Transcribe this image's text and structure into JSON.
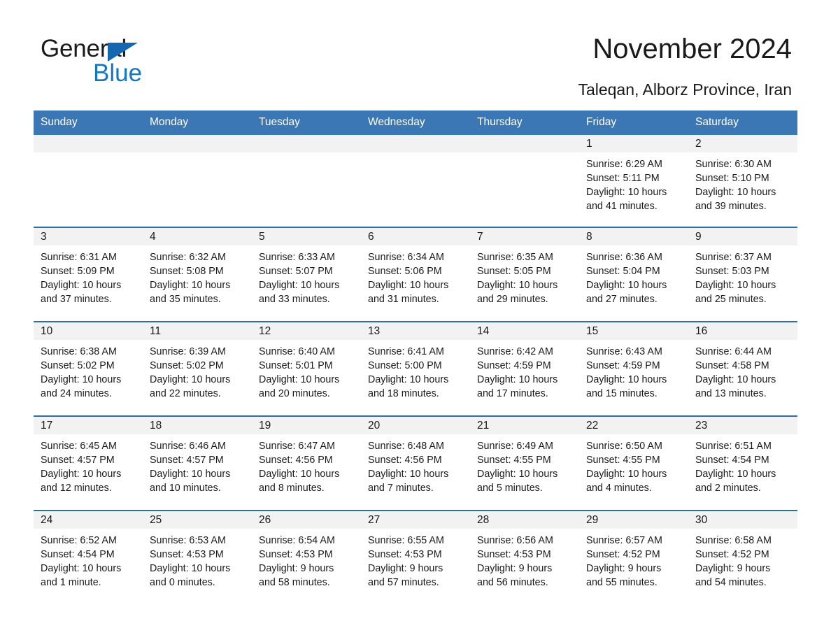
{
  "brand": {
    "name_part1": "General",
    "name_part2": "Blue",
    "triangle_color": "#1267b0",
    "blue_color": "#1276c3"
  },
  "header": {
    "title": "November 2024",
    "subtitle": "Taleqan, Alborz Province, Iran"
  },
  "theme": {
    "header_row_bg": "#3b77b5",
    "row_divider": "#2e6da4",
    "daynum_band_bg": "#f2f2f2",
    "text": "#1a1a1a"
  },
  "weekdays": [
    "Sunday",
    "Monday",
    "Tuesday",
    "Wednesday",
    "Thursday",
    "Friday",
    "Saturday"
  ],
  "weeks": [
    [
      {
        "day": "",
        "sunrise": "",
        "sunset": "",
        "daylight_line1": "",
        "daylight_line2": ""
      },
      {
        "day": "",
        "sunrise": "",
        "sunset": "",
        "daylight_line1": "",
        "daylight_line2": ""
      },
      {
        "day": "",
        "sunrise": "",
        "sunset": "",
        "daylight_line1": "",
        "daylight_line2": ""
      },
      {
        "day": "",
        "sunrise": "",
        "sunset": "",
        "daylight_line1": "",
        "daylight_line2": ""
      },
      {
        "day": "",
        "sunrise": "",
        "sunset": "",
        "daylight_line1": "",
        "daylight_line2": ""
      },
      {
        "day": "1",
        "sunrise": "Sunrise: 6:29 AM",
        "sunset": "Sunset: 5:11 PM",
        "daylight_line1": "Daylight: 10 hours",
        "daylight_line2": "and 41 minutes."
      },
      {
        "day": "2",
        "sunrise": "Sunrise: 6:30 AM",
        "sunset": "Sunset: 5:10 PM",
        "daylight_line1": "Daylight: 10 hours",
        "daylight_line2": "and 39 minutes."
      }
    ],
    [
      {
        "day": "3",
        "sunrise": "Sunrise: 6:31 AM",
        "sunset": "Sunset: 5:09 PM",
        "daylight_line1": "Daylight: 10 hours",
        "daylight_line2": "and 37 minutes."
      },
      {
        "day": "4",
        "sunrise": "Sunrise: 6:32 AM",
        "sunset": "Sunset: 5:08 PM",
        "daylight_line1": "Daylight: 10 hours",
        "daylight_line2": "and 35 minutes."
      },
      {
        "day": "5",
        "sunrise": "Sunrise: 6:33 AM",
        "sunset": "Sunset: 5:07 PM",
        "daylight_line1": "Daylight: 10 hours",
        "daylight_line2": "and 33 minutes."
      },
      {
        "day": "6",
        "sunrise": "Sunrise: 6:34 AM",
        "sunset": "Sunset: 5:06 PM",
        "daylight_line1": "Daylight: 10 hours",
        "daylight_line2": "and 31 minutes."
      },
      {
        "day": "7",
        "sunrise": "Sunrise: 6:35 AM",
        "sunset": "Sunset: 5:05 PM",
        "daylight_line1": "Daylight: 10 hours",
        "daylight_line2": "and 29 minutes."
      },
      {
        "day": "8",
        "sunrise": "Sunrise: 6:36 AM",
        "sunset": "Sunset: 5:04 PM",
        "daylight_line1": "Daylight: 10 hours",
        "daylight_line2": "and 27 minutes."
      },
      {
        "day": "9",
        "sunrise": "Sunrise: 6:37 AM",
        "sunset": "Sunset: 5:03 PM",
        "daylight_line1": "Daylight: 10 hours",
        "daylight_line2": "and 25 minutes."
      }
    ],
    [
      {
        "day": "10",
        "sunrise": "Sunrise: 6:38 AM",
        "sunset": "Sunset: 5:02 PM",
        "daylight_line1": "Daylight: 10 hours",
        "daylight_line2": "and 24 minutes."
      },
      {
        "day": "11",
        "sunrise": "Sunrise: 6:39 AM",
        "sunset": "Sunset: 5:02 PM",
        "daylight_line1": "Daylight: 10 hours",
        "daylight_line2": "and 22 minutes."
      },
      {
        "day": "12",
        "sunrise": "Sunrise: 6:40 AM",
        "sunset": "Sunset: 5:01 PM",
        "daylight_line1": "Daylight: 10 hours",
        "daylight_line2": "and 20 minutes."
      },
      {
        "day": "13",
        "sunrise": "Sunrise: 6:41 AM",
        "sunset": "Sunset: 5:00 PM",
        "daylight_line1": "Daylight: 10 hours",
        "daylight_line2": "and 18 minutes."
      },
      {
        "day": "14",
        "sunrise": "Sunrise: 6:42 AM",
        "sunset": "Sunset: 4:59 PM",
        "daylight_line1": "Daylight: 10 hours",
        "daylight_line2": "and 17 minutes."
      },
      {
        "day": "15",
        "sunrise": "Sunrise: 6:43 AM",
        "sunset": "Sunset: 4:59 PM",
        "daylight_line1": "Daylight: 10 hours",
        "daylight_line2": "and 15 minutes."
      },
      {
        "day": "16",
        "sunrise": "Sunrise: 6:44 AM",
        "sunset": "Sunset: 4:58 PM",
        "daylight_line1": "Daylight: 10 hours",
        "daylight_line2": "and 13 minutes."
      }
    ],
    [
      {
        "day": "17",
        "sunrise": "Sunrise: 6:45 AM",
        "sunset": "Sunset: 4:57 PM",
        "daylight_line1": "Daylight: 10 hours",
        "daylight_line2": "and 12 minutes."
      },
      {
        "day": "18",
        "sunrise": "Sunrise: 6:46 AM",
        "sunset": "Sunset: 4:57 PM",
        "daylight_line1": "Daylight: 10 hours",
        "daylight_line2": "and 10 minutes."
      },
      {
        "day": "19",
        "sunrise": "Sunrise: 6:47 AM",
        "sunset": "Sunset: 4:56 PM",
        "daylight_line1": "Daylight: 10 hours",
        "daylight_line2": "and 8 minutes."
      },
      {
        "day": "20",
        "sunrise": "Sunrise: 6:48 AM",
        "sunset": "Sunset: 4:56 PM",
        "daylight_line1": "Daylight: 10 hours",
        "daylight_line2": "and 7 minutes."
      },
      {
        "day": "21",
        "sunrise": "Sunrise: 6:49 AM",
        "sunset": "Sunset: 4:55 PM",
        "daylight_line1": "Daylight: 10 hours",
        "daylight_line2": "and 5 minutes."
      },
      {
        "day": "22",
        "sunrise": "Sunrise: 6:50 AM",
        "sunset": "Sunset: 4:55 PM",
        "daylight_line1": "Daylight: 10 hours",
        "daylight_line2": "and 4 minutes."
      },
      {
        "day": "23",
        "sunrise": "Sunrise: 6:51 AM",
        "sunset": "Sunset: 4:54 PM",
        "daylight_line1": "Daylight: 10 hours",
        "daylight_line2": "and 2 minutes."
      }
    ],
    [
      {
        "day": "24",
        "sunrise": "Sunrise: 6:52 AM",
        "sunset": "Sunset: 4:54 PM",
        "daylight_line1": "Daylight: 10 hours",
        "daylight_line2": "and 1 minute."
      },
      {
        "day": "25",
        "sunrise": "Sunrise: 6:53 AM",
        "sunset": "Sunset: 4:53 PM",
        "daylight_line1": "Daylight: 10 hours",
        "daylight_line2": "and 0 minutes."
      },
      {
        "day": "26",
        "sunrise": "Sunrise: 6:54 AM",
        "sunset": "Sunset: 4:53 PM",
        "daylight_line1": "Daylight: 9 hours",
        "daylight_line2": "and 58 minutes."
      },
      {
        "day": "27",
        "sunrise": "Sunrise: 6:55 AM",
        "sunset": "Sunset: 4:53 PM",
        "daylight_line1": "Daylight: 9 hours",
        "daylight_line2": "and 57 minutes."
      },
      {
        "day": "28",
        "sunrise": "Sunrise: 6:56 AM",
        "sunset": "Sunset: 4:53 PM",
        "daylight_line1": "Daylight: 9 hours",
        "daylight_line2": "and 56 minutes."
      },
      {
        "day": "29",
        "sunrise": "Sunrise: 6:57 AM",
        "sunset": "Sunset: 4:52 PM",
        "daylight_line1": "Daylight: 9 hours",
        "daylight_line2": "and 55 minutes."
      },
      {
        "day": "30",
        "sunrise": "Sunrise: 6:58 AM",
        "sunset": "Sunset: 4:52 PM",
        "daylight_line1": "Daylight: 9 hours",
        "daylight_line2": "and 54 minutes."
      }
    ]
  ]
}
